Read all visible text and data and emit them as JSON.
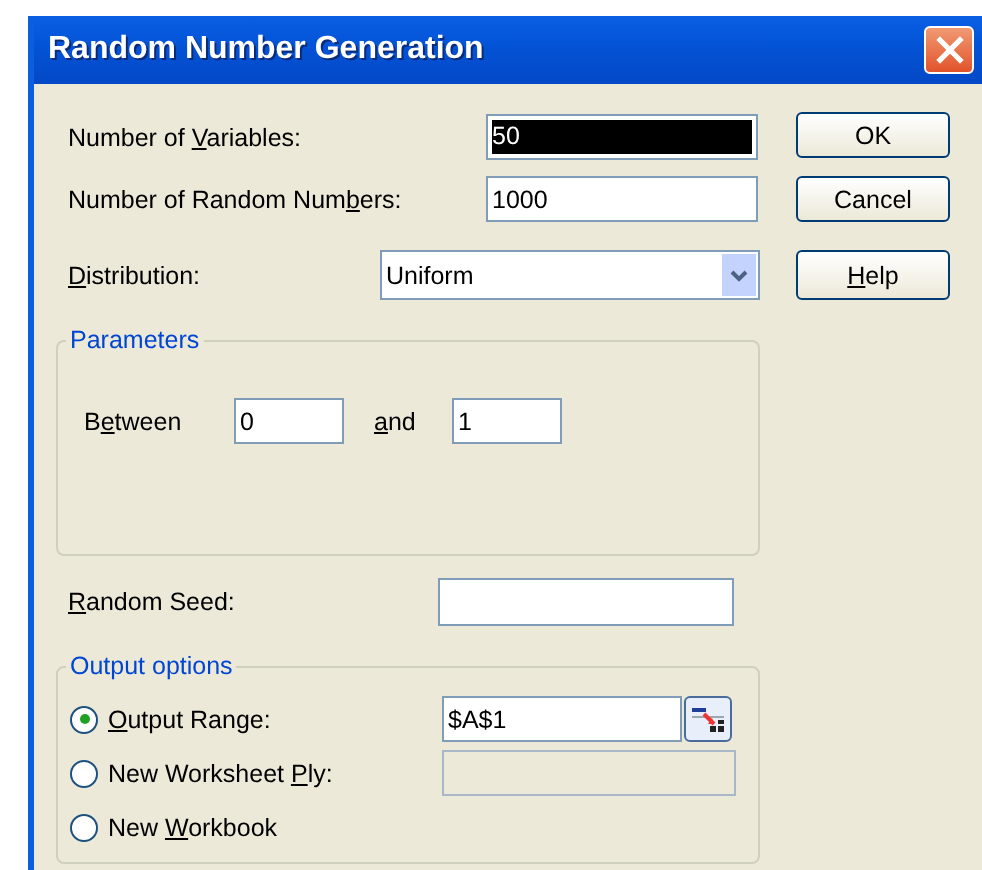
{
  "window": {
    "title": "Random Number Generation"
  },
  "fields": [
    {
      "label": [
        {
          "t": "Number of ",
          "underlined": false
        },
        {
          "t": "V",
          "underlined": true
        },
        {
          "t": "ariables:",
          "underlined": false
        }
      ],
      "value": "50",
      "selected": true
    },
    {
      "label": [
        {
          "t": "Number of Random Num",
          "underlined": false
        },
        {
          "t": "b",
          "underlined": true
        },
        {
          "t": "ers:",
          "underlined": false
        }
      ],
      "value": "1000",
      "selected": false
    }
  ],
  "distribution": {
    "label": [
      {
        "t": "D",
        "underlined": true
      },
      {
        "t": "istribution:",
        "underlined": false
      }
    ],
    "value": "Uniform"
  },
  "buttons": [
    {
      "label": [
        {
          "t": "OK",
          "underlined": false
        }
      ]
    },
    {
      "label": [
        {
          "t": "Cancel",
          "underlined": false
        }
      ]
    },
    {
      "label": [
        {
          "t": "H",
          "underlined": true
        },
        {
          "t": "elp",
          "underlined": false
        }
      ]
    }
  ],
  "parameters": {
    "title": "Parameters",
    "between_label": [
      {
        "t": "B",
        "underlined": false
      },
      {
        "t": "e",
        "underlined": true
      },
      {
        "t": "tween",
        "underlined": false
      }
    ],
    "from": "0",
    "and_label": [
      {
        "t": "a",
        "underlined": true
      },
      {
        "t": "nd",
        "underlined": false
      }
    ],
    "to": "1"
  },
  "random_seed": {
    "label": [
      {
        "t": "R",
        "underlined": true
      },
      {
        "t": "andom Seed:",
        "underlined": false
      }
    ]
  },
  "output_options": {
    "title": "Output options",
    "options": [
      {
        "kind": "range",
        "label": [
          {
            "t": "O",
            "underlined": true
          },
          {
            "t": "utput Range:",
            "underlined": false
          }
        ],
        "selected": true,
        "value": "$A$1"
      },
      {
        "kind": "ply",
        "label": [
          {
            "t": "New Worksheet ",
            "underlined": false
          },
          {
            "t": "P",
            "underlined": true
          },
          {
            "t": "ly:",
            "underlined": false
          }
        ],
        "selected": false,
        "disabled": true
      },
      {
        "kind": "plain",
        "label": [
          {
            "t": "New ",
            "underlined": false
          },
          {
            "t": "W",
            "underlined": true
          },
          {
            "t": "orkbook",
            "underlined": false
          }
        ],
        "selected": false
      }
    ]
  }
}
